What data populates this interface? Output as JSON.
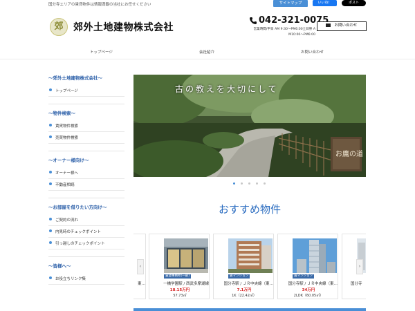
{
  "topbar": {
    "tagline": "国分寺エリアの賃貸物件は情報満載の当社にお任せください",
    "sitemap_label": "サイトマップ",
    "fb_label": "いいね！",
    "x_label": "ポスト"
  },
  "header": {
    "logo_char": "郊",
    "company_name": "郊外土地建物株式会社",
    "phone": "042-321-0075",
    "hours_line1": "営業時間/平日 AM 9:30〜PM6:00土日祭 A",
    "hours_line2": "M10:00〜PM6:00",
    "contact_label": "お問い合わせ"
  },
  "nav": {
    "items": [
      {
        "label": "トップページ"
      },
      {
        "label": "会社紹介"
      },
      {
        "label": "お問い合わせ"
      }
    ]
  },
  "sidebar": {
    "sections": [
      {
        "title": "～郊外土地建物株式会社～",
        "items": [
          "トップページ"
        ]
      },
      {
        "title": "～物件検索～",
        "items": [
          "賃貸物件検索",
          "売買物件検索"
        ]
      },
      {
        "title": "～オーナー様向け～",
        "items": [
          "オーナー様へ",
          "不動産相続"
        ]
      },
      {
        "title": "～お部屋を借りたい方向け～",
        "items": [
          "ご契約の流れ",
          "内見時のチェックポイント",
          "引っ越しのチェックポイント"
        ]
      },
      {
        "title": "～皆様へ～",
        "items": [
          "お役立ちリンク集"
        ]
      }
    ]
  },
  "hero": {
    "text": "古の教えを大切にして",
    "sign_text": "お鷹の道",
    "dot_count": 5,
    "active_dot": 0
  },
  "recommend": {
    "title": "おすすめ物件",
    "cards": [
      {
        "badge": "",
        "station": "東…",
        "price": "",
        "spec": "㎡）"
      },
      {
        "badge": "賃貸事務所(一部)",
        "station": "一橋学園駅 / 西武多摩湖線",
        "price": "18.15万円",
        "spec": "57.73㎡"
      },
      {
        "badge": "賃マンション",
        "station": "国分寺駅 / ＪＲ中央線（東…",
        "price": "7.1万円",
        "spec": "1K（22.42㎡）"
      },
      {
        "badge": "賃マンション",
        "station": "国分寺駅 / ＪＲ中央線（東…",
        "price": "34万円",
        "spec": "2LDK（60.05㎡）"
      },
      {
        "badge": "",
        "station": "国分寺",
        "price": "",
        "spec": ""
      }
    ],
    "prev_label": "‹",
    "next_label": "›"
  },
  "colors": {
    "accent": "#4a8fd6",
    "heading_blue": "#2a6cc0",
    "price_red": "#d62020"
  }
}
